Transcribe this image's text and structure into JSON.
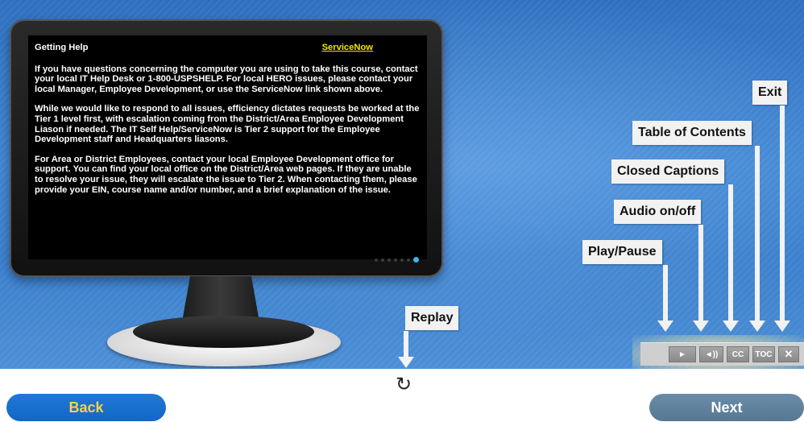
{
  "screen": {
    "title": "Getting Help",
    "link": "ServiceNow",
    "paragraphs": [
      "If you have questions concerning the computer you are using to take this course, contact your local IT Help Desk or 1-800-USPSHELP. For local HERO issues, please contact your local Manager, Employee Development, or use the ServiceNow link shown above.",
      "While we would like to respond to all issues, efficiency dictates requests be worked at the Tier 1 level first, with escalation coming from the District/Area Employee Development Liason if needed. The IT Self Help/ServiceNow is Tier 2 support for the Employee Development staff and Headquarters liasons.",
      "For Area or District Employees, contact your local Employee Development office for support. You can find your local office on the District/Area web pages. If they are unable to resolve your issue, they will escalate the issue to Tier 2. When contacting them, please provide your EIN, course name and/or number, and a brief explanation of the issue."
    ]
  },
  "callouts": {
    "exit": "Exit",
    "toc": "Table of Contents",
    "cc": "Closed Captions",
    "audio": "Audio on/off",
    "play": "Play/Pause",
    "replay": "Replay"
  },
  "controls": {
    "play": "►",
    "audio": "◄))",
    "cc": "CC",
    "toc": "TOC",
    "exit": "✕"
  },
  "nav": {
    "back": "Back",
    "next": "Next"
  },
  "icons": {
    "replay": "↻"
  }
}
